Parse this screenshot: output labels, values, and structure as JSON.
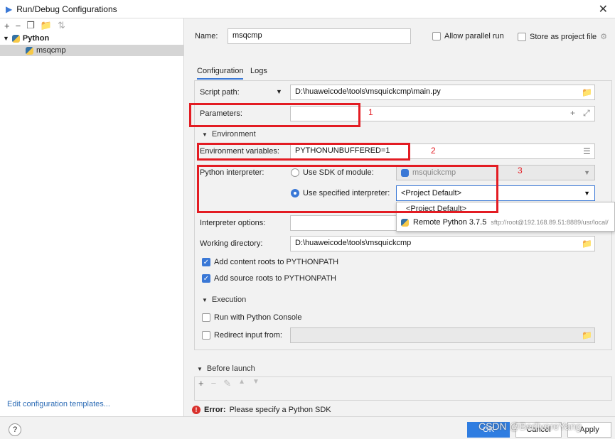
{
  "window": {
    "title": "Run/Debug Configurations"
  },
  "tree": {
    "group": "Python",
    "item": "msqcmp"
  },
  "left_link": "Edit configuration templates...",
  "name": {
    "label": "Name:",
    "value": "msqcmp"
  },
  "allow_parallel": "Allow parallel run",
  "store_project": "Store as project file",
  "tabs": [
    "Configuration",
    "Logs"
  ],
  "script": {
    "label": "Script path:",
    "value": "D:\\huaweicode\\tools\\msquickcmp\\main.py"
  },
  "parameters": {
    "label": "Parameters:",
    "value": ""
  },
  "environment": {
    "section": "Environment",
    "env_label": "Environment variables:",
    "env_value": "PYTHONUNBUFFERED=1"
  },
  "interpreter": {
    "label": "Python interpreter:",
    "sdk_option": "Use SDK of module:",
    "sdk_value": "msquickcmp",
    "specified_option": "Use specified interpreter:",
    "specified_value": "<Project Default>"
  },
  "dropdown": {
    "item1": "<Project Default>",
    "item2": "Remote Python 3.7.5",
    "item2_detail": "sftp://root@192.168.89.51:8889/usr/local/"
  },
  "interp_options": {
    "label": "Interpreter options:"
  },
  "workdir": {
    "label": "Working directory:",
    "value": "D:\\huaweicode\\tools\\msquickcmp"
  },
  "add_content": "Add content roots to PYTHONPATH",
  "add_source": "Add source roots to PYTHONPATH",
  "execution": {
    "section": "Execution",
    "console": "Run with Python Console",
    "redirect": "Redirect input from:"
  },
  "before_launch": "Before launch",
  "error": {
    "prefix": "Error:",
    "message": "Please specify a Python SDK"
  },
  "annotations": [
    "1",
    "2",
    "3"
  ],
  "buttons": {
    "ok": "OK",
    "cancel": "Cancel",
    "apply": "Apply",
    "help": "?"
  },
  "watermark": "CSDN @BedivereYang"
}
